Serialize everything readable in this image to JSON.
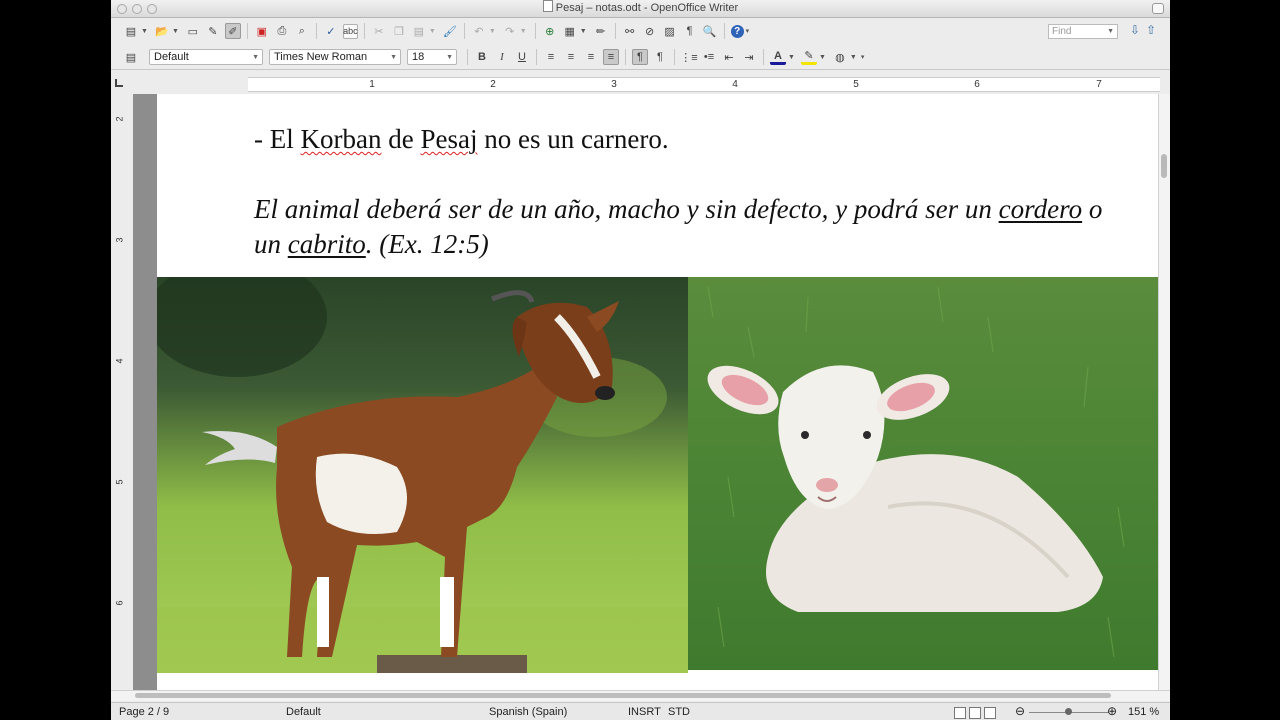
{
  "window": {
    "title": "Pesaj – notas.odt - OpenOffice Writer"
  },
  "toolbar": {
    "style": "Default",
    "font": "Times New Roman",
    "size": "18",
    "bold": "B",
    "italic": "I",
    "underline": "U",
    "find_placeholder": "Find"
  },
  "ruler": {
    "h": [
      "1",
      "2",
      "3",
      "4",
      "5",
      "6",
      "7"
    ],
    "v": [
      "2",
      "3",
      "4",
      "5",
      "6"
    ]
  },
  "document": {
    "line1_a": "- El ",
    "line1_b": "Korban",
    "line1_c": " de ",
    "line1_d": "Pesaj",
    "line1_e": " no es un carnero.",
    "italic_a": "El animal deberá ser de un año, macho y sin defecto, y podrá ser un ",
    "italic_b": "cordero",
    "italic_c": " o un ",
    "italic_d": "cabrito",
    "italic_e": ". (Ex. 12:5)"
  },
  "statusbar": {
    "page": "Page 2 / 9",
    "style": "Default",
    "language": "Spanish (Spain)",
    "insert": "INSRT",
    "selection": "STD",
    "zoom": "151 %"
  },
  "zoom_level_percent": 151
}
